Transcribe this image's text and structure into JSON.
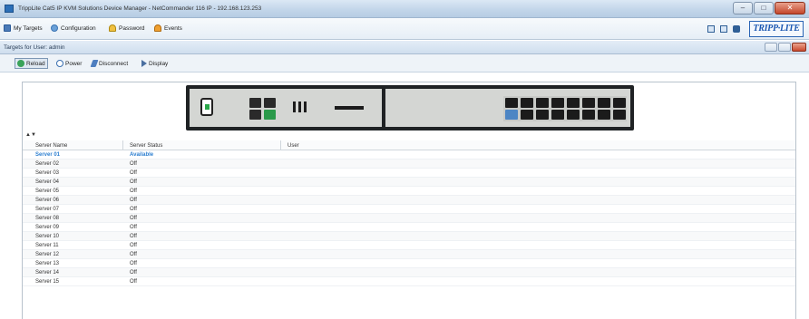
{
  "window": {
    "title": "TrippLite Cat5 IP KVM Solutions Device Manager - NetCommander 116 IP - 192.168.123.253"
  },
  "toolbar": {
    "items": [
      {
        "label": "My Targets",
        "icon": "targets-icon"
      },
      {
        "label": "Configuration",
        "icon": "configuration-icon"
      },
      {
        "label": "Password",
        "icon": "password-icon"
      },
      {
        "label": "Events",
        "icon": "events-icon"
      }
    ],
    "logo": "TRIPP·LITE"
  },
  "subwindow": {
    "title": "Targets for User: admin"
  },
  "subtoolbar": {
    "items": [
      {
        "label": "Reload",
        "icon": "reload-icon"
      },
      {
        "label": "Power",
        "icon": "power-icon"
      },
      {
        "label": "Disconnect",
        "icon": "disconnect-icon"
      },
      {
        "label": "Display",
        "icon": "display-icon"
      }
    ]
  },
  "table": {
    "headers": [
      "Server Name",
      "Server Status",
      "User"
    ],
    "rows": [
      {
        "name": "Server 01",
        "status": "Available",
        "user": ""
      },
      {
        "name": "Server 02",
        "status": "Off",
        "user": ""
      },
      {
        "name": "Server 03",
        "status": "Off",
        "user": ""
      },
      {
        "name": "Server 04",
        "status": "Off",
        "user": ""
      },
      {
        "name": "Server 05",
        "status": "Off",
        "user": ""
      },
      {
        "name": "Server 06",
        "status": "Off",
        "user": ""
      },
      {
        "name": "Server 07",
        "status": "Off",
        "user": ""
      },
      {
        "name": "Server 08",
        "status": "Off",
        "user": ""
      },
      {
        "name": "Server 09",
        "status": "Off",
        "user": ""
      },
      {
        "name": "Server 10",
        "status": "Off",
        "user": ""
      },
      {
        "name": "Server 11",
        "status": "Off",
        "user": ""
      },
      {
        "name": "Server 12",
        "status": "Off",
        "user": ""
      },
      {
        "name": "Server 13",
        "status": "Off",
        "user": ""
      },
      {
        "name": "Server 14",
        "status": "Off",
        "user": ""
      },
      {
        "name": "Server 15",
        "status": "Off",
        "user": ""
      }
    ]
  }
}
